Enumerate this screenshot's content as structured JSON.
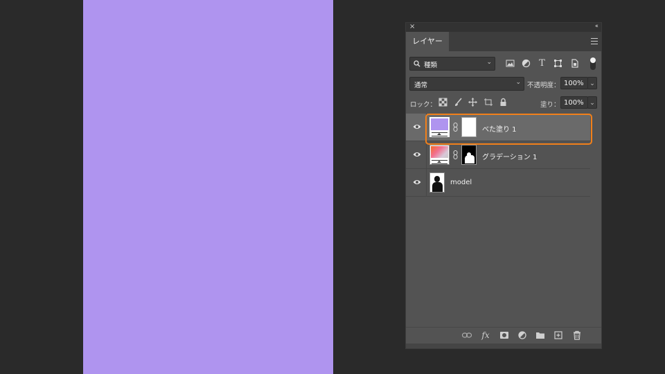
{
  "canvas": {
    "fill_color": "#af94ef"
  },
  "panel": {
    "close_icon": "×",
    "collapse_icon": "‹‹",
    "tab_label": "レイヤー",
    "filter": {
      "value": "種類",
      "search_icon": "search-icon"
    },
    "blend_mode": "通常",
    "opacity_label": "不透明度：",
    "opacity_value": "100%",
    "lock_label": "ロック：",
    "fill_label": "塗り：",
    "fill_value": "100%",
    "chevron": "⌄"
  },
  "layers": [
    {
      "name": "べた塗り 1",
      "selected": true,
      "color": "#af94ef"
    },
    {
      "name": "グラデーション 1",
      "selected": false
    },
    {
      "name": "model",
      "selected": false
    }
  ],
  "accent": "#f2801a"
}
